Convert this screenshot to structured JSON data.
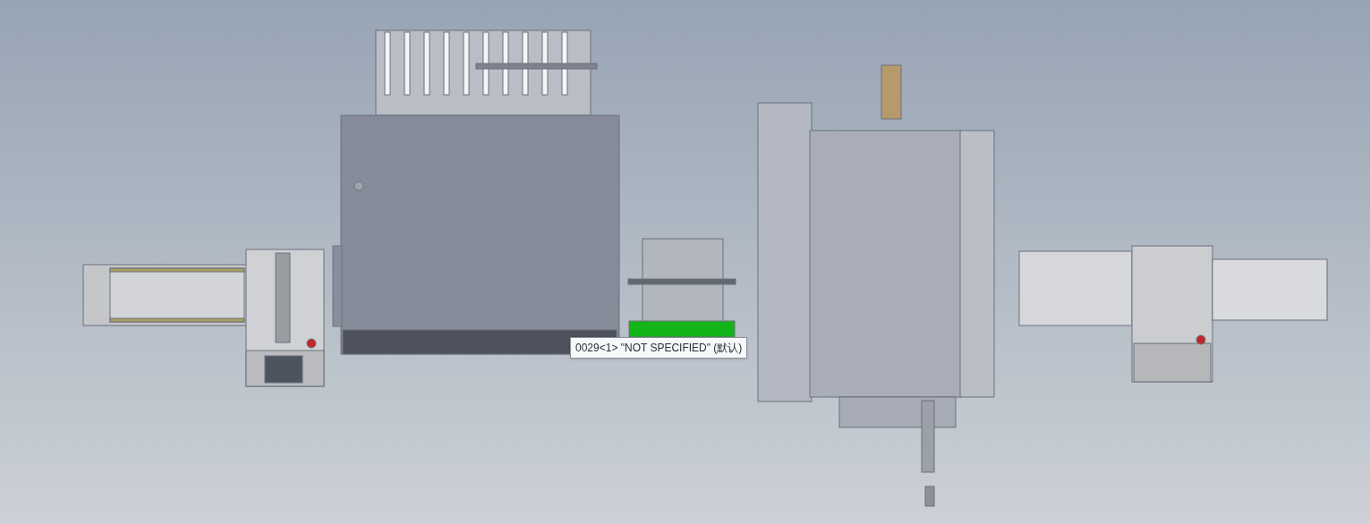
{
  "viewport": {
    "tooltip": "0029<1> \"NOT SPECIFIED\" (默认)"
  }
}
